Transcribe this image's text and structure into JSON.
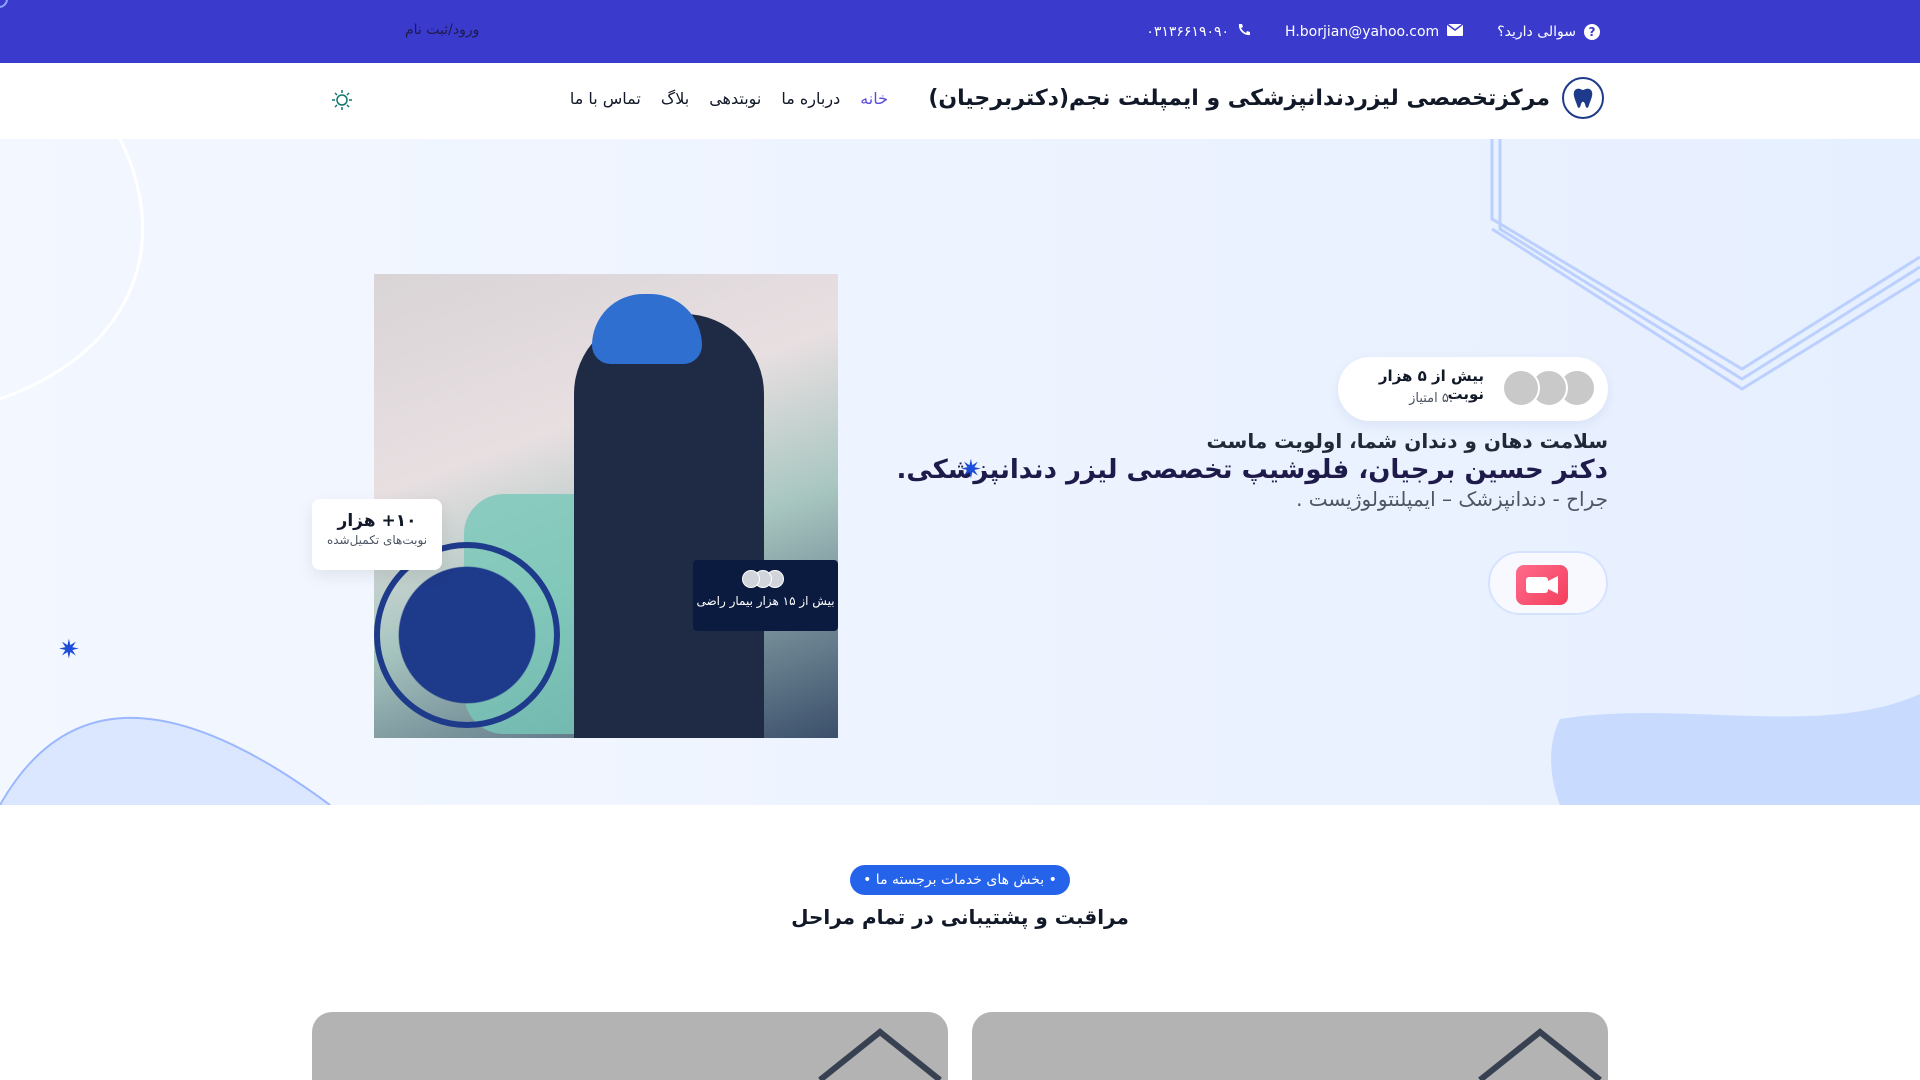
{
  "topbar": {
    "question": "سوالی دارید؟",
    "email": "H.borjian@yahoo.com",
    "phone": "۰۳۱۳۶۶۱۹۰۹۰",
    "login": "ورود/ثبت نام"
  },
  "nav": {
    "brand_title": "مرکزتخصصی لیزردندانپزشکی و ایمپلنت نجم(دکتربرجیان)",
    "items": [
      {
        "label": "خانه",
        "active": true
      },
      {
        "label": "درباره ما"
      },
      {
        "label": "نوبتدهی"
      },
      {
        "label": "بلاگ"
      },
      {
        "label": "تماس با ما"
      }
    ]
  },
  "hero": {
    "badge_title": "بیش از ۵ هزار نوبت",
    "badge_rating": "۵.۰ امتیاز",
    "line1": "سلامت دهان و دندان شما، اولویت ماست",
    "line2": "دکتر حسین برجیان، فلوشیپ تخصصی لیزر دندانپزشکی.",
    "line3": "جراح - دندانپزشک – ایمپلنتولوژیست .",
    "completed_value": "۱۰+ هزار",
    "completed_label": "نوبت‌های تکمیل‌شده",
    "satisfied_label": "بیش از ۱۵ هزار بیمار راضی"
  },
  "section": {
    "pill": "• بخش های خدمات برجسته ما •",
    "title": "مراقبت و پشتیبانی در تمام مراحل"
  },
  "colors": {
    "topbar": "#3a3acd",
    "accent": "#2563eb",
    "dark_card": "#0b1b3f"
  },
  "icons": [
    "question-icon",
    "mail-icon",
    "phone-icon",
    "tooth-logo-icon",
    "sun-icon",
    "video-camera-icon",
    "sparkle-icon"
  ]
}
